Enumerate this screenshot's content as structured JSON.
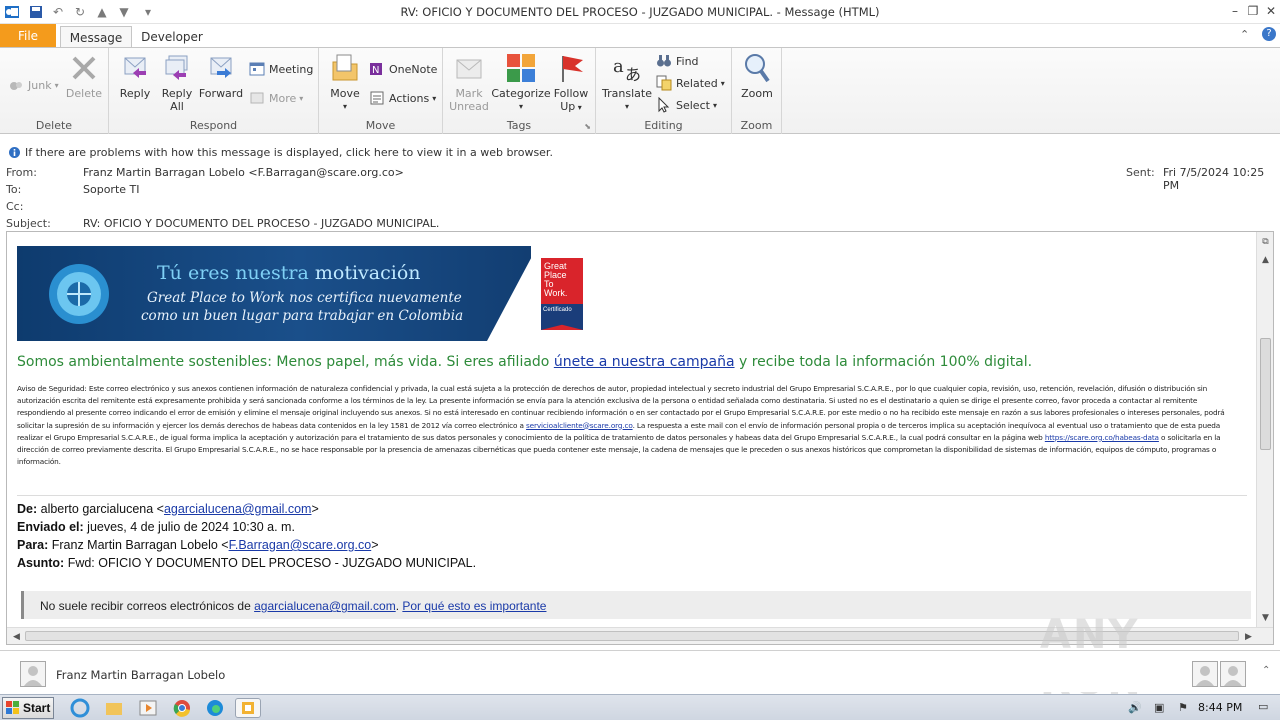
{
  "window": {
    "title": "RV: OFICIO Y DOCUMENTO DEL PROCESO - JUZGADO MUNICIPAL.  -  Message (HTML)"
  },
  "tabs": {
    "file": "File",
    "message": "Message",
    "developer": "Developer"
  },
  "ribbon": {
    "delete": {
      "label": "Delete",
      "junk": "Junk",
      "delete_btn": "Delete"
    },
    "respond": {
      "label": "Respond",
      "reply": "Reply",
      "reply_all_1": "Reply",
      "reply_all_2": "All",
      "forward": "Forward",
      "meeting": "Meeting",
      "more": "More"
    },
    "move": {
      "label": "Move",
      "move_btn": "Move",
      "onenote": "OneNote",
      "actions": "Actions"
    },
    "tags": {
      "label": "Tags",
      "mark_unread_1": "Mark",
      "mark_unread_2": "Unread",
      "categorize": "Categorize",
      "follow_up_1": "Follow",
      "follow_up_2": "Up"
    },
    "editing": {
      "label": "Editing",
      "translate": "Translate",
      "find": "Find",
      "related": "Related",
      "select": "Select"
    },
    "zoom": {
      "label": "Zoom",
      "zoom_btn": "Zoom"
    }
  },
  "infobar": {
    "text": "If there are problems with how this message is displayed, click here to view it in a web browser."
  },
  "header": {
    "from_label": "From:",
    "from_value": "Franz Martin Barragan Lobelo <F.Barragan@scare.org.co>",
    "to_label": "To:",
    "to_value": "Soporte TI",
    "cc_label": "Cc:",
    "cc_value": "",
    "subject_label": "Subject:",
    "subject_value": "RV: OFICIO Y DOCUMENTO DEL PROCESO - JUZGADO MUNICIPAL.",
    "sent_label": "Sent:",
    "sent_value": "Fri 7/5/2024 10:25 PM"
  },
  "banner": {
    "line1a": "Tú eres nuestra ",
    "line1b": "motivación",
    "line2": "Great Place to Work nos certifica nuevamente",
    "line3": "como un buen lugar para trabajar en Colombia",
    "badge_1": "Great",
    "badge_2": "Place",
    "badge_3": "To",
    "badge_4": "Work.",
    "badge_cert": "Certificado"
  },
  "body": {
    "green_a": "Somos ambientalmente sostenibles: Menos papel, más vida. Si eres afiliado ",
    "green_link": "únete a nuestra campaña",
    "green_b": " y recibe toda la información 100% digital.",
    "disclaimer_a": "Aviso de Seguridad: Este correo electrónico y sus anexos contienen información de naturaleza confidencial y privada, la cual está sujeta a la protección de derechos de autor, propiedad intelectual y secreto industrial del Grupo Empresarial S.C.A.R.E., por lo que cualquier copia, revisión, uso, retención, revelación, difusión o distribución sin autorización escrita del remitente está expresamente prohibida y será sancionada conforme a los términos de la ley. La presente información se envía para la atención exclusiva de la persona o entidad señalada como destinataria. Si usted no es el destinatario a quien se dirige el presente correo, favor proceda a contactar al remitente respondiendo al presente correo indicando el error de emisión y elimine el mensaje original incluyendo sus anexos. Si no está interesado en continuar recibiendo información o en ser contactado por el Grupo Empresarial S.C.A.R.E. por este medio o no ha recibido este mensaje en razón a sus labores profesionales o intereses personales, podrá solicitar la supresión de su información y ejercer los demás derechos de habeas data contenidos en la ley 1581 de 2012 vía correo electrónico a ",
    "disclaimer_link1": "servicioalcliente@scare.org.co",
    "disclaimer_b": ". La respuesta a este mail con el envío de información personal propia o de terceros implica su aceptación inequívoca al eventual uso o tratamiento que de esta pueda realizar el Grupo Empresarial S.C.A.R.E., de igual forma implica la aceptación y autorización para el tratamiento de sus datos personales y conocimiento de la política de tratamiento de datos personales y habeas data del Grupo Empresarial S.C.A.R.E., la cual podrá consultar en la página web ",
    "disclaimer_link2": "https://scare.org.co/habeas-data",
    "disclaimer_c": " o solicitarla en la dirección de correo previamente descrita. El Grupo Empresarial S.C.A.R.E., no se hace responsable por la presencia de amenazas cibernéticas que pueda contener este mensaje, la cadena de mensajes que le preceden o sus anexos históricos que comprometan la disponibilidad de sistemas de información, equipos de cómputo, programas o información."
  },
  "forwarded": {
    "de_label": "De:",
    "de_name": " alberto garcialucena <",
    "de_email": "agarcialucena@gmail.com",
    "de_end": ">",
    "enviado_label": "Enviado el:",
    "enviado_value": " jueves, 4 de julio de 2024 10:30 a. m.",
    "para_label": "Para:",
    "para_name": " Franz Martin Barragan Lobelo <",
    "para_email": "F.Barragan@scare.org.co",
    "para_end": ">",
    "asunto_label": "Asunto:",
    "asunto_value": " Fwd: OFICIO Y DOCUMENTO DEL PROCESO - JUZGADO MUNICIPAL."
  },
  "notice": {
    "text": "No suele recibir correos electrónicos de ",
    "email": "agarcialucena@gmail.com",
    "sep": ". ",
    "link": "Por qué esto es importante"
  },
  "people": {
    "name": "Franz Martin Barragan Lobelo"
  },
  "taskbar": {
    "start": "Start",
    "clock": "8:44 PM"
  },
  "watermark": "ANY RUN",
  "colors": {
    "file_tab": "#f49b1c",
    "link": "#1a3aa8",
    "green_text": "#2e8b3a",
    "banner": "#1a4f8a",
    "gptw_red": "#d9242b"
  }
}
